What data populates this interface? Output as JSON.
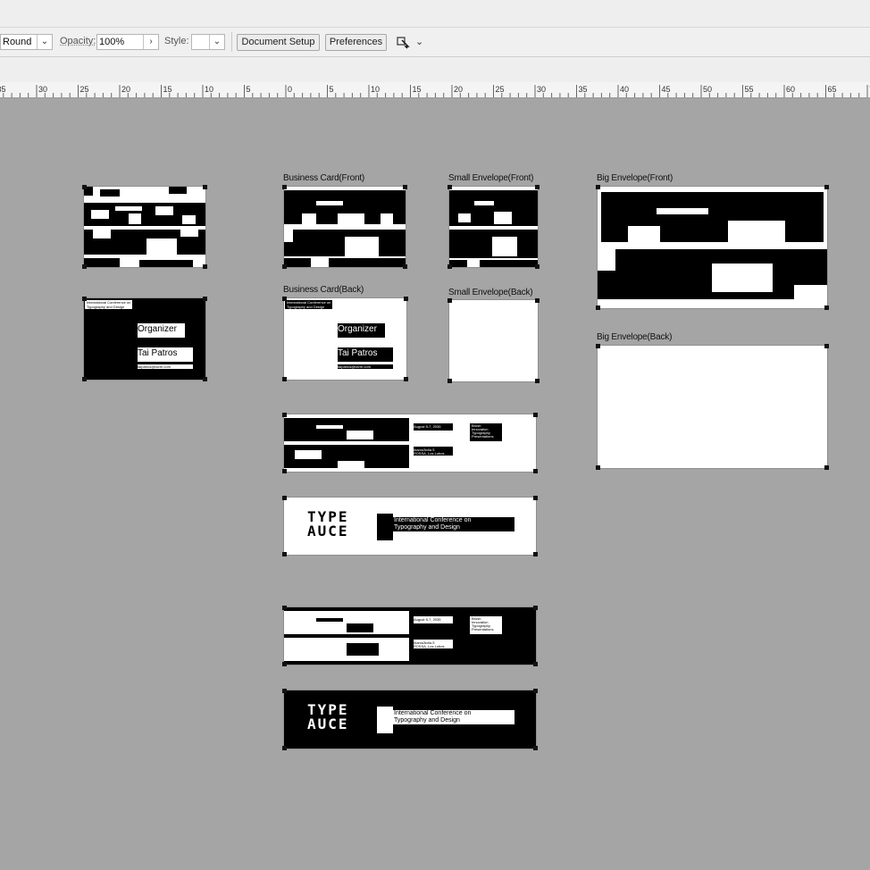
{
  "control_bar": {
    "stroke_profile": {
      "value": "Round"
    },
    "opacity": {
      "label": "Opacity:",
      "value": "100%"
    },
    "style": {
      "label": "Style:"
    },
    "document_setup_label": "Document Setup",
    "preferences_label": "Preferences"
  },
  "ruler": {
    "labels": [
      "35",
      "30",
      "25",
      "20",
      "15",
      "10",
      "5",
      "0",
      "5",
      "10",
      "15",
      "20",
      "25",
      "30",
      "35",
      "40",
      "45",
      "50",
      "55",
      "60",
      "65",
      "70"
    ]
  },
  "artboards": {
    "business_card_front": "Business Card(Front)",
    "business_card_back": "Business Card(Back)",
    "small_envelope_front": "Small Envelope(Front)",
    "small_envelope_back": "Small Envelope(Back)",
    "big_envelope_front": "Big Envelope(Front)",
    "big_envelope_back": "Big Envelope(Back)"
  },
  "card_back": {
    "header_line1": "International Conference on",
    "header_line2": "Typography and Design",
    "role": "Organizer",
    "name": "Tai Patros",
    "email": "taipatros@tavre.com"
  },
  "banner": {
    "logo_line1": "TYPE",
    "logo_line2": "AUCE",
    "conf_line1": "International Conference on",
    "conf_line2": "Typography and Design",
    "date": "August 5-7, 2035",
    "venue_line1": "Ibarra/Avila 5",
    "venue_line2": "POSSA, Los Lobos",
    "topics": [
      "Brush",
      "Innovation",
      "Typography",
      "Presentations"
    ]
  },
  "colors": {
    "canvas": "#a5a5a5",
    "ink": "#000000",
    "paper": "#ffffff"
  }
}
